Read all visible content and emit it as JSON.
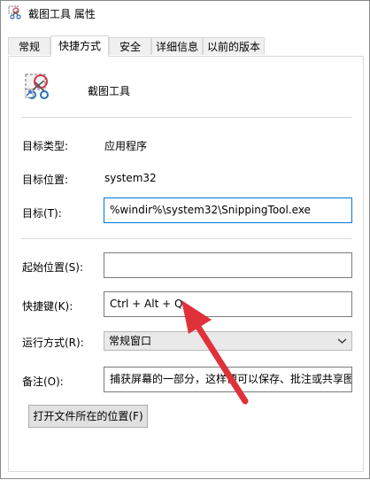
{
  "window": {
    "title": "截图工具 属性"
  },
  "tabs": [
    {
      "label": "常规"
    },
    {
      "label": "快捷方式"
    },
    {
      "label": "安全"
    },
    {
      "label": "详细信息"
    },
    {
      "label": "以前的版本"
    }
  ],
  "header": {
    "app_name": "截图工具"
  },
  "fields": {
    "target_type_label": "目标类型:",
    "target_type_value": "应用程序",
    "target_location_label": "目标位置:",
    "target_location_value": "system32",
    "target_label": "目标(T):",
    "target_value": "%windir%\\system32\\SnippingTool.exe",
    "start_in_label": "起始位置(S):",
    "start_in_value": "",
    "shortcut_key_label": "快捷键(K):",
    "shortcut_key_value": "Ctrl + Alt + Q",
    "run_label": "运行方式(R):",
    "run_value": "常规窗口",
    "comment_label": "备注(O):",
    "comment_value": "捕获屏幕的一部分，这样便可以保存、批注或共享图像。"
  },
  "buttons": {
    "open_location": "打开文件所在的位置(F)"
  },
  "colors": {
    "annotation_arrow": "#e0313a",
    "focus_border": "#0078d7"
  }
}
